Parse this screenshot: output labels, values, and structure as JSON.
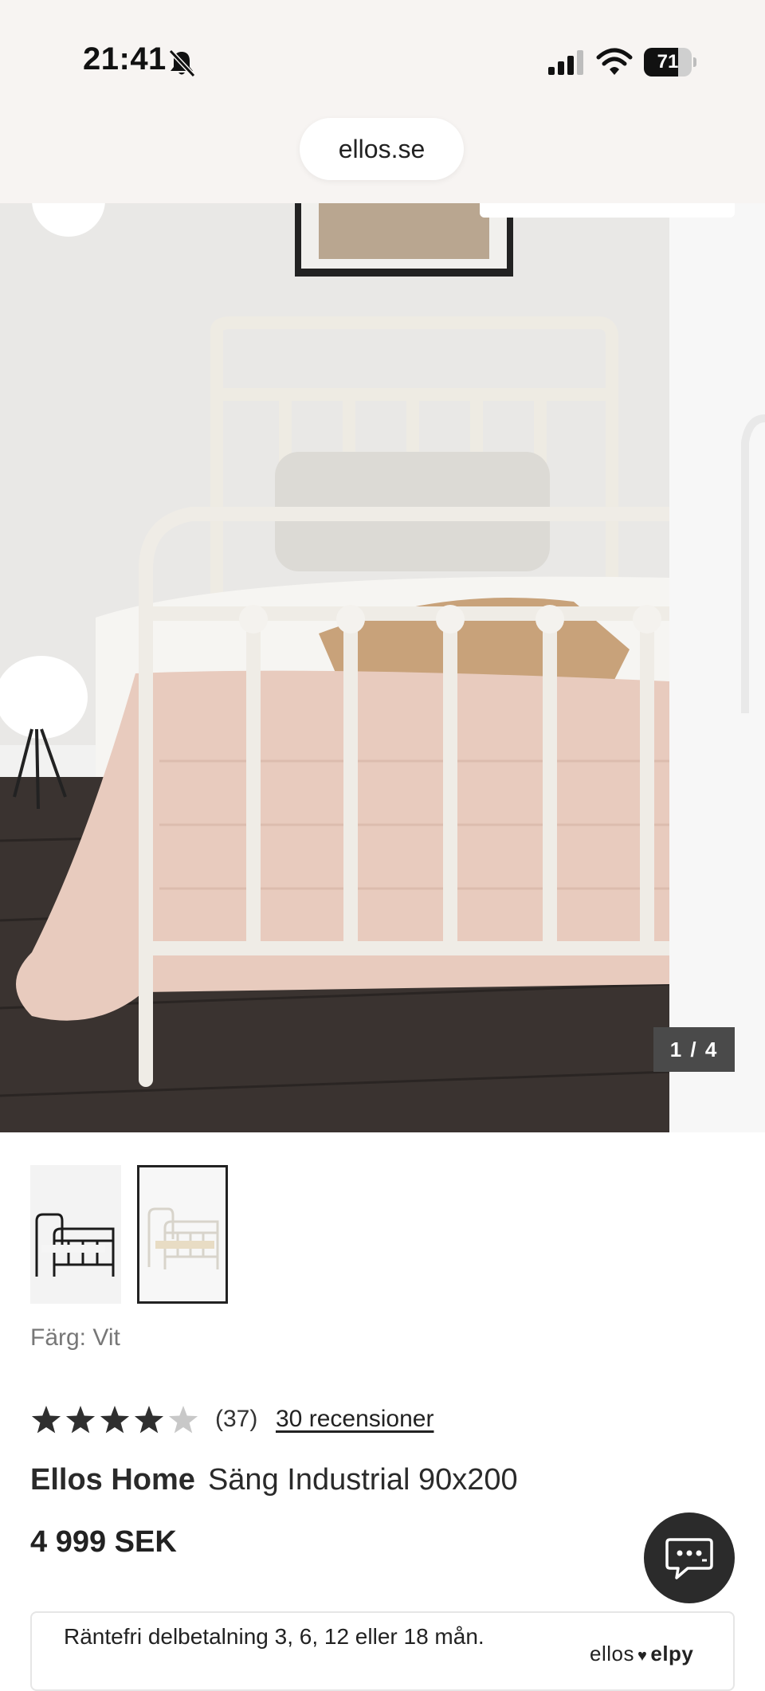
{
  "status_bar": {
    "time": "21:41",
    "icons": [
      "bell-slash-icon",
      "cellular-signal-icon",
      "wifi-icon",
      "battery-icon"
    ],
    "battery_percent": "71",
    "battery_level": 0.71
  },
  "browser": {
    "url": "ellos.se"
  },
  "gallery": {
    "counter": "1 / 4",
    "current_image": 1,
    "total_images": 4
  },
  "thumbnails": [
    {
      "color_name": "Svart",
      "frame_color": "#1b1b1b",
      "selected": false
    },
    {
      "color_name": "Vit",
      "frame_color": "#e9e6df",
      "selected": true
    }
  ],
  "product": {
    "color_label": "Färg: Vit",
    "rating_value": 4,
    "rating_max": 5,
    "rating_count": "(37)",
    "reviews_link": "30 recensioner",
    "brand": "Ellos Home",
    "name": "Säng Industrial 90x200",
    "price": "4 999 SEK"
  },
  "finance": {
    "text": "Räntefri delbetalning 3, 6, 12 eller 18 mån.",
    "logo_left": "ellos",
    "logo_right": "elpy"
  },
  "chat": {
    "icon": "chat-bubble-icon"
  },
  "colors": {
    "header_bg": "#f7f4f2",
    "dark_button": "#2b2b2b",
    "star_filled": "#2f2f2f",
    "star_empty": "#c8c8c8"
  }
}
